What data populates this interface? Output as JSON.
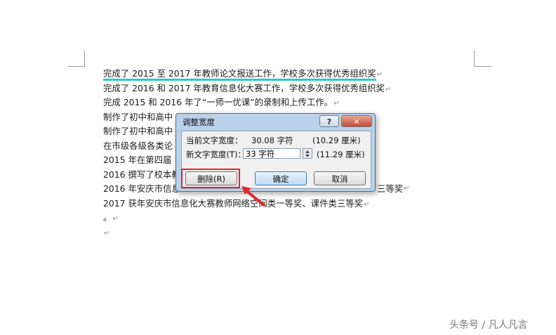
{
  "document": {
    "lines": [
      "完成了 2015 至 2017 年教师论文报送工作，学校多次获得优秀组织奖",
      "完成了 2016 和 2017 年教育信息化大赛工作，学校多次获得优秀组织奖",
      "完成 2015 和 2016 年了“一师一优课”的录制和上传工作。",
      "制作了初中和高中",
      "制作了初中和高中",
      "在市级各级各类论",
      "2015 年在第四届《",
      "2016 撰写了校本教",
      "2016 年安庆市信息",
      "2017 获年安庆市信息化大赛教师网络空间类一等奖、课件类三等奖",
      "。",
      ""
    ],
    "line9_tail": "三等奖",
    "paragraph_mark": "↵"
  },
  "dialog": {
    "title": "调整宽度",
    "help_label": "?",
    "close_label": "✕",
    "current_label": "当前文字宽度：",
    "current_value": "30.08 字符",
    "current_mm": "(10.29 厘米)",
    "new_label": "新文字宽度(T)：",
    "new_value": "33 字符",
    "new_mm": "(11.29 厘米)",
    "delete_button": "删除(R)",
    "ok_button": "确定",
    "cancel_button": "取消"
  },
  "watermark": "头条号 / 凡人凡言",
  "colors": {
    "highlight": "#e02828",
    "selection_underline": "#2bc9cc",
    "dialog_frame": "#b9d1ea"
  }
}
